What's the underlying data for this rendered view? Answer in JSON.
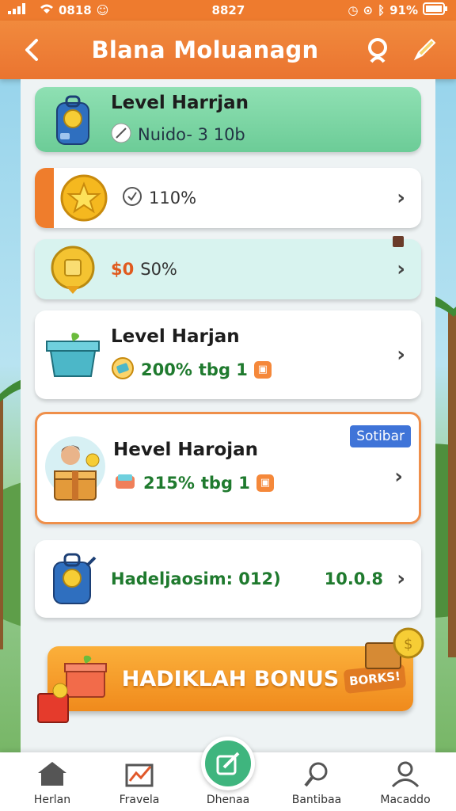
{
  "status_bar": {
    "left_text": "0818",
    "extra_icon": "☺",
    "center_time": "8827",
    "battery_text": "91%"
  },
  "header": {
    "title": "Blana Moluanagn",
    "back_icon": "chevron-left-icon",
    "search_icon": "search-icon",
    "edit_icon": "pencil-icon"
  },
  "cards": [
    {
      "title": "Level Harrjan",
      "subtitle": "Nuido- 3 10b"
    },
    {
      "value": "110%"
    },
    {
      "value_prefix": "$0",
      "value": "S0%"
    },
    {
      "title": "Level Harjan",
      "value": "200%",
      "suffix": "tbg 1"
    },
    {
      "title": "Hevel Harojan",
      "value": "215%",
      "suffix": "tbg 1",
      "tag": "Sotibar"
    },
    {
      "label": "Hadeljaosim: 012)",
      "value": "10.0.8"
    }
  ],
  "bonus": {
    "label": "HADIKLAH BONUS",
    "tag": "BORKS!"
  },
  "nav": [
    {
      "label": "Herlan"
    },
    {
      "label": "Fravela"
    },
    {
      "label": "Dhenaa"
    },
    {
      "label": "Bantibaa"
    },
    {
      "label": "Macaddo"
    }
  ],
  "colors": {
    "accent": "#ee7b2e",
    "green_card": "#7fd4a6",
    "value_green": "#1f7a2e",
    "tag_blue": "#3f74d8"
  }
}
